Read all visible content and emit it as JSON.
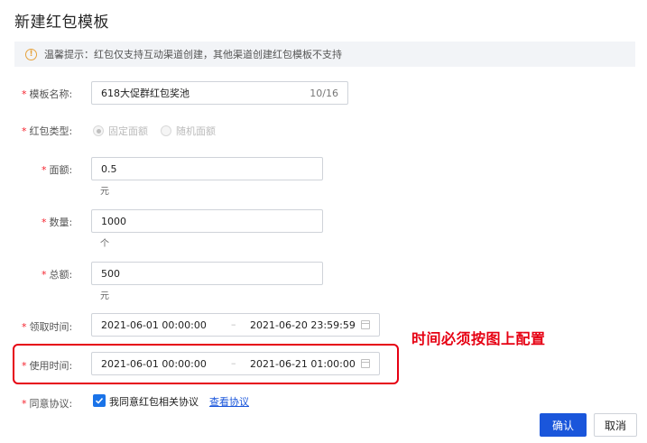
{
  "page": {
    "title": "新建红包模板"
  },
  "notice": {
    "icon": "info-circle-icon",
    "text": "温馨提示：红包仅支持互动渠道创建，其他渠道创建红包模板不支持"
  },
  "form": {
    "template_name": {
      "label": "模板名称:",
      "value": "618大促群红包奖池",
      "count": "10/16"
    },
    "packet_type": {
      "label": "红包类型:",
      "options": [
        "固定面额",
        "随机面额"
      ],
      "selected": "固定面额"
    },
    "denomination": {
      "label": "面额:",
      "value": "0.5",
      "unit": "元"
    },
    "quantity": {
      "label": "数量:",
      "value": "1000",
      "unit": "个"
    },
    "total": {
      "label": "总额:",
      "value": "500",
      "unit": "元"
    },
    "claim_time": {
      "label": "领取时间:",
      "start": "2021-06-01 00:00:00",
      "separator": "–",
      "end": "2021-06-20 23:59:59"
    },
    "use_time": {
      "label": "使用时间:",
      "start": "2021-06-01 00:00:00",
      "separator": "–",
      "end": "2021-06-21 01:00:00"
    },
    "agreement": {
      "label": "同意协议:",
      "checked": true,
      "text": "我同意红包相关协议",
      "link": "查看协议"
    }
  },
  "annotation": {
    "text": "时间必须按图上配置",
    "color": "#e60012"
  },
  "buttons": {
    "confirm": "确认",
    "cancel": "取消"
  },
  "colors": {
    "primary": "#1a56db",
    "required_star": "#f5222d",
    "warning_icon": "#e6a23c",
    "highlight": "#e60012"
  }
}
